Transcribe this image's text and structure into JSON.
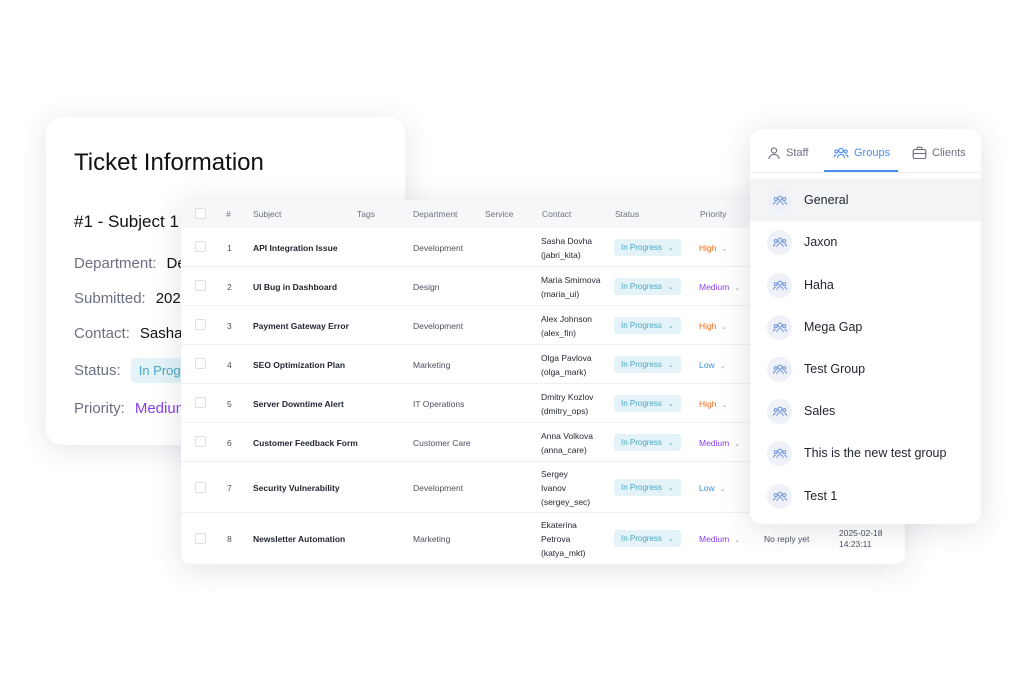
{
  "ticket": {
    "title": "Ticket Information",
    "subject": "#1 - Subject 1",
    "department": {
      "label": "Department:",
      "value": "De"
    },
    "submitted": {
      "label": "Submitted:",
      "value": "202"
    },
    "contact": {
      "label": "Contact:",
      "value": "Sasha"
    },
    "status": {
      "label": "Status:",
      "value": "In Progr"
    },
    "priority": {
      "label": "Priority:",
      "value": "Medium"
    }
  },
  "table": {
    "headers": {
      "num": "#",
      "subject": "Subject",
      "tags": "Tags",
      "department": "Department",
      "service": "Service",
      "contact": "Contact",
      "status": "Status",
      "priority": "Priority"
    },
    "rows": [
      {
        "num": "1",
        "subject": "API Integration Issue",
        "department": "Development",
        "contact": [
          "Sasha Dovha",
          "(jabri_kita)"
        ],
        "status": "In Progress",
        "priority": "High"
      },
      {
        "num": "2",
        "subject": "UI Bug in Dashboard",
        "department": "Design",
        "contact": [
          "Maria Smirnova",
          "(maria_ui)"
        ],
        "status": "In Progress",
        "priority": "Medium"
      },
      {
        "num": "3",
        "subject": "Payment Gateway Error",
        "department": "Development",
        "contact": [
          "Alex Johnson",
          "(alex_fin)"
        ],
        "status": "In Progress",
        "priority": "High"
      },
      {
        "num": "4",
        "subject": "SEO Optimization Plan",
        "department": "Marketing",
        "contact": [
          "Olga Pavlova",
          "(olga_mark)"
        ],
        "status": "In Progress",
        "priority": "Low"
      },
      {
        "num": "5",
        "subject": "Server Downtime Alert",
        "department": "IT Operations",
        "contact": [
          "Dmitry Kozlov",
          "(dmitry_ops)"
        ],
        "status": "In Progress",
        "priority": "High"
      },
      {
        "num": "6",
        "subject": "Customer Feedback Form",
        "department": "Customer Care",
        "contact": [
          "Anna Volkova",
          "(anna_care)"
        ],
        "status": "In Progress",
        "priority": "Medium"
      },
      {
        "num": "7",
        "subject": "Security Vulnerability",
        "department": "Development",
        "contact": [
          "Sergey",
          "Ivanov",
          "(sergey_sec)"
        ],
        "status": "In Progress",
        "priority": "Low"
      },
      {
        "num": "8",
        "subject": "Newsletter Automation",
        "department": "Marketing",
        "contact": [
          "Ekaterina",
          "Petrova",
          "(katya_mkt)"
        ],
        "status": "In Progress",
        "priority": "Medium",
        "reply": "No reply yet",
        "date": [
          "2025-02-18",
          "14:23:11"
        ]
      }
    ]
  },
  "groups_panel": {
    "tabs": {
      "staff": "Staff",
      "groups": "Groups",
      "clients": "Clients"
    },
    "active_tab": "Groups",
    "items": [
      "General",
      "Jaxon",
      "Haha",
      "Mega Gap",
      "Test Group",
      "Sales",
      "This is the new test group",
      "Test 1"
    ],
    "selected_item": "General"
  },
  "colors": {
    "accent": "#4a8ef0",
    "status_bg": "#e3f3f8",
    "status_text": "#4aa6c4",
    "priority_high": "#ef6a1a",
    "priority_medium": "#8a3ff0",
    "priority_low": "#3d8fe0"
  },
  "icons": {
    "staff_tab": "person-icon",
    "groups_tab": "users-group-icon",
    "clients_tab": "briefcase-icon",
    "group_avatar": "users-group-icon",
    "dropdown": "chevron-down-icon"
  }
}
